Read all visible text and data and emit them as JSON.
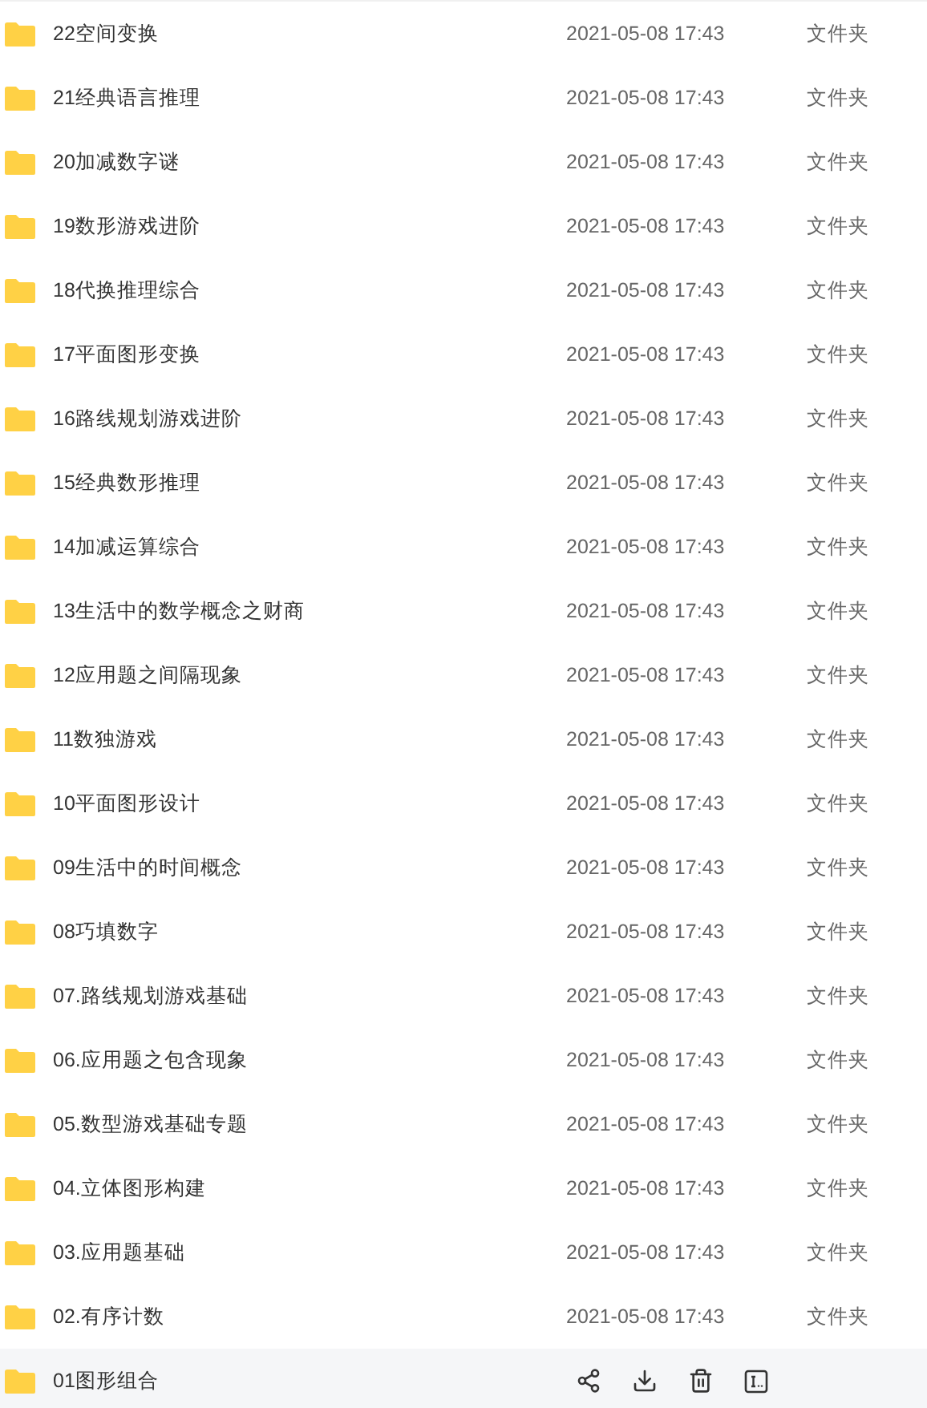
{
  "files": [
    {
      "name": "22空间变换",
      "date": "2021-05-08 17:43",
      "type": "文件夹",
      "hovered": false
    },
    {
      "name": "21经典语言推理",
      "date": "2021-05-08 17:43",
      "type": "文件夹",
      "hovered": false
    },
    {
      "name": "20加减数字谜",
      "date": "2021-05-08 17:43",
      "type": "文件夹",
      "hovered": false
    },
    {
      "name": "19数形游戏进阶",
      "date": "2021-05-08 17:43",
      "type": "文件夹",
      "hovered": false
    },
    {
      "name": "18代换推理综合",
      "date": "2021-05-08 17:43",
      "type": "文件夹",
      "hovered": false
    },
    {
      "name": "17平面图形变换",
      "date": "2021-05-08 17:43",
      "type": "文件夹",
      "hovered": false
    },
    {
      "name": "16路线规划游戏进阶",
      "date": "2021-05-08 17:43",
      "type": "文件夹",
      "hovered": false
    },
    {
      "name": "15经典数形推理",
      "date": "2021-05-08 17:43",
      "type": "文件夹",
      "hovered": false
    },
    {
      "name": "14加减运算综合",
      "date": "2021-05-08 17:43",
      "type": "文件夹",
      "hovered": false
    },
    {
      "name": "13生活中的数学概念之财商",
      "date": "2021-05-08 17:43",
      "type": "文件夹",
      "hovered": false
    },
    {
      "name": "12应用题之间隔现象",
      "date": "2021-05-08 17:43",
      "type": "文件夹",
      "hovered": false
    },
    {
      "name": "11数独游戏",
      "date": "2021-05-08 17:43",
      "type": "文件夹",
      "hovered": false
    },
    {
      "name": "10平面图形设计",
      "date": "2021-05-08 17:43",
      "type": "文件夹",
      "hovered": false
    },
    {
      "name": "09生活中的时间概念",
      "date": "2021-05-08 17:43",
      "type": "文件夹",
      "hovered": false
    },
    {
      "name": "08巧填数字",
      "date": "2021-05-08 17:43",
      "type": "文件夹",
      "hovered": false
    },
    {
      "name": "07.路线规划游戏基础",
      "date": "2021-05-08 17:43",
      "type": "文件夹",
      "hovered": false
    },
    {
      "name": "06.应用题之包含现象",
      "date": "2021-05-08 17:43",
      "type": "文件夹",
      "hovered": false
    },
    {
      "name": "05.数型游戏基础专题",
      "date": "2021-05-08 17:43",
      "type": "文件夹",
      "hovered": false
    },
    {
      "name": "04.立体图形构建",
      "date": "2021-05-08 17:43",
      "type": "文件夹",
      "hovered": false
    },
    {
      "name": "03.应用题基础",
      "date": "2021-05-08 17:43",
      "type": "文件夹",
      "hovered": false
    },
    {
      "name": "02.有序计数",
      "date": "2021-05-08 17:43",
      "type": "文件夹",
      "hovered": false
    },
    {
      "name": "01图形组合",
      "hovered": true
    }
  ]
}
